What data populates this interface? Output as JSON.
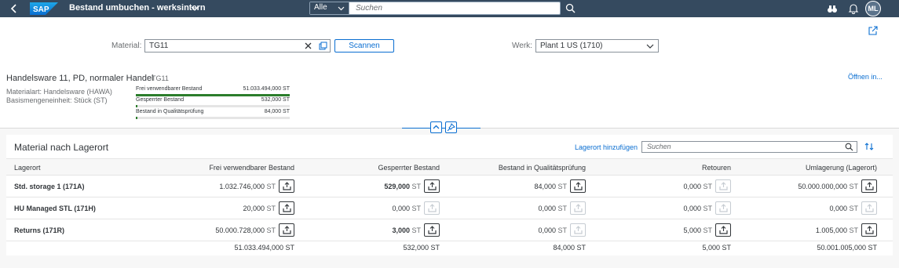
{
  "shell": {
    "title": "Bestand umbuchen - werksintern",
    "scope": "Alle",
    "search_placeholder": "Suchen",
    "user_initials": "ML"
  },
  "filter": {
    "material_label": "Material:",
    "material_value": "TG11",
    "scan_label": "Scannen",
    "plant_label": "Werk:",
    "plant_value": "Plant 1 US (1710)"
  },
  "object": {
    "title": "Handelsware 11, PD, normaler Handel",
    "id": "TG11",
    "material_type": "Materialart: Handelsware (HAWA)",
    "base_unit": "Basismengeneinheit: Stück (ST)",
    "open_link": "Öffnen in...",
    "stock_bars": [
      {
        "label": "Frei verwendbarer Bestand",
        "value": "51.033.494,000 ST",
        "fill": 1.0
      },
      {
        "label": "Gesperrter Bestand",
        "value": "532,000 ST",
        "fill": 0.0104
      },
      {
        "label": "Bestand in Qualitätsprüfung",
        "value": "84,000 ST",
        "fill": 0.0016
      }
    ]
  },
  "panel": {
    "title": "Material nach Lagerort",
    "add_link": "Lagerort hinzufügen",
    "search_placeholder": "Suchen",
    "columns": [
      "Lagerort",
      "Frei verwendbarer Bestand",
      "Gesperrter Bestand",
      "Bestand in Qualitätsprüfung",
      "Retouren",
      "Umlagerung (Lagerort)"
    ],
    "rows": [
      {
        "name": "Std. storage 1 (171A)",
        "values": [
          "1.032.746,000",
          "529,000",
          "84,000",
          "0,000",
          "50.000.000,000"
        ],
        "unit": "ST"
      },
      {
        "name": "HU Managed STL (171H)",
        "values": [
          "20,000",
          "0,000",
          "0,000",
          "0,000",
          "0,000"
        ],
        "unit": "ST"
      },
      {
        "name": "Returns (171R)",
        "values": [
          "50.000.728,000",
          "3,000",
          "0,000",
          "5,000",
          "1.005,000"
        ],
        "unit": "ST"
      }
    ],
    "totals": [
      "51.033.494,000 ST",
      "532,000 ST",
      "84,000 ST",
      "5,000 ST",
      "50.001.005,000 ST"
    ]
  },
  "colors": {
    "shell_bg": "#354a5f",
    "accent": "#0a6ed1",
    "positive": "#2b7d2b"
  }
}
